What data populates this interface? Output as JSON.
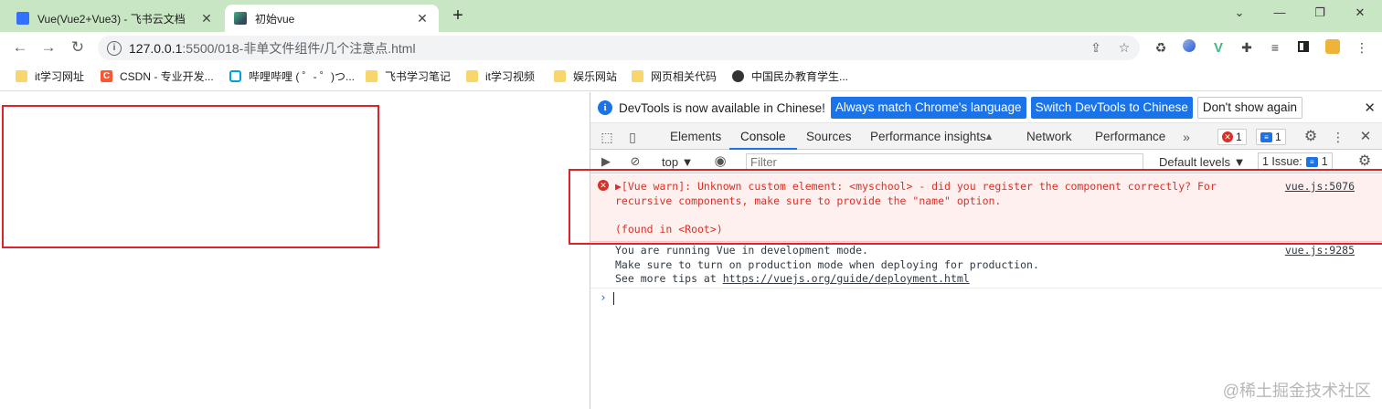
{
  "browser": {
    "tabs": [
      {
        "title": "Vue(Vue2+Vue3) - 飞书云文档",
        "close": "✕"
      },
      {
        "title": "初始vue",
        "close": "✕"
      }
    ],
    "new_tab": "+",
    "window_controls": {
      "minimize": "⌄",
      "min": "—",
      "max": "❐",
      "close": "✕"
    },
    "nav": {
      "back": "←",
      "forward": "→",
      "reload": "↻"
    },
    "address": {
      "info": "i",
      "host": "127.0.0.1",
      "path": ":5500/018-非单文件组件/几个注意点.html"
    },
    "bookmarks": [
      {
        "label": "it学习网址",
        "type": "folder"
      },
      {
        "label": "CSDN - 专业开发...",
        "type": "csdn"
      },
      {
        "label": "哔哩哔哩 ( ゜- ゜)つ...",
        "type": "bili"
      },
      {
        "label": "飞书学习笔记",
        "type": "folder"
      },
      {
        "label": "it学习视频",
        "type": "folder"
      },
      {
        "label": "娱乐网站",
        "type": "folder"
      },
      {
        "label": "网页相关代码",
        "type": "folder"
      },
      {
        "label": "中国民办教育学生...",
        "type": "globe"
      }
    ]
  },
  "devtools": {
    "infobar": {
      "message": "DevTools is now available in Chinese!",
      "btn_match": "Always match Chrome's language",
      "btn_switch": "Switch DevTools to Chinese",
      "btn_dismiss": "Don't show again",
      "close": "✕"
    },
    "tabs": [
      "Elements",
      "Console",
      "Sources",
      "Performance insights",
      "Network",
      "Performance"
    ],
    "more_tabs": "»",
    "error_count": "1",
    "message_count": "1",
    "console_toolbar": {
      "context": "top ▼",
      "filter_placeholder": "Filter",
      "levels": "Default levels ▼",
      "issues": "1 Issue:",
      "issues_count": "1"
    },
    "logs": {
      "warn_line1": "▶[Vue warn]: Unknown custom element: <myschool> - did you register the component correctly? For",
      "warn_line2": "recursive components, make sure to provide the \"name\" option.",
      "warn_line3": "(found in <Root>)",
      "warn_source": "vue.js:5076",
      "info_line1": "You are running Vue in development mode.",
      "info_line2": "Make sure to turn on production mode when deploying for production.",
      "info_line3_prefix": "See more tips at ",
      "info_link": "https://vuejs.org/guide/deployment.html",
      "info_source": "vue.js:9285",
      "prompt": "›"
    }
  },
  "watermark": "@稀土掘金技术社区",
  "colors": {
    "annotation": "#e0222b",
    "tabstrip": "#c8e6c3",
    "accent": "#1a73e8",
    "error": "#d93025"
  }
}
